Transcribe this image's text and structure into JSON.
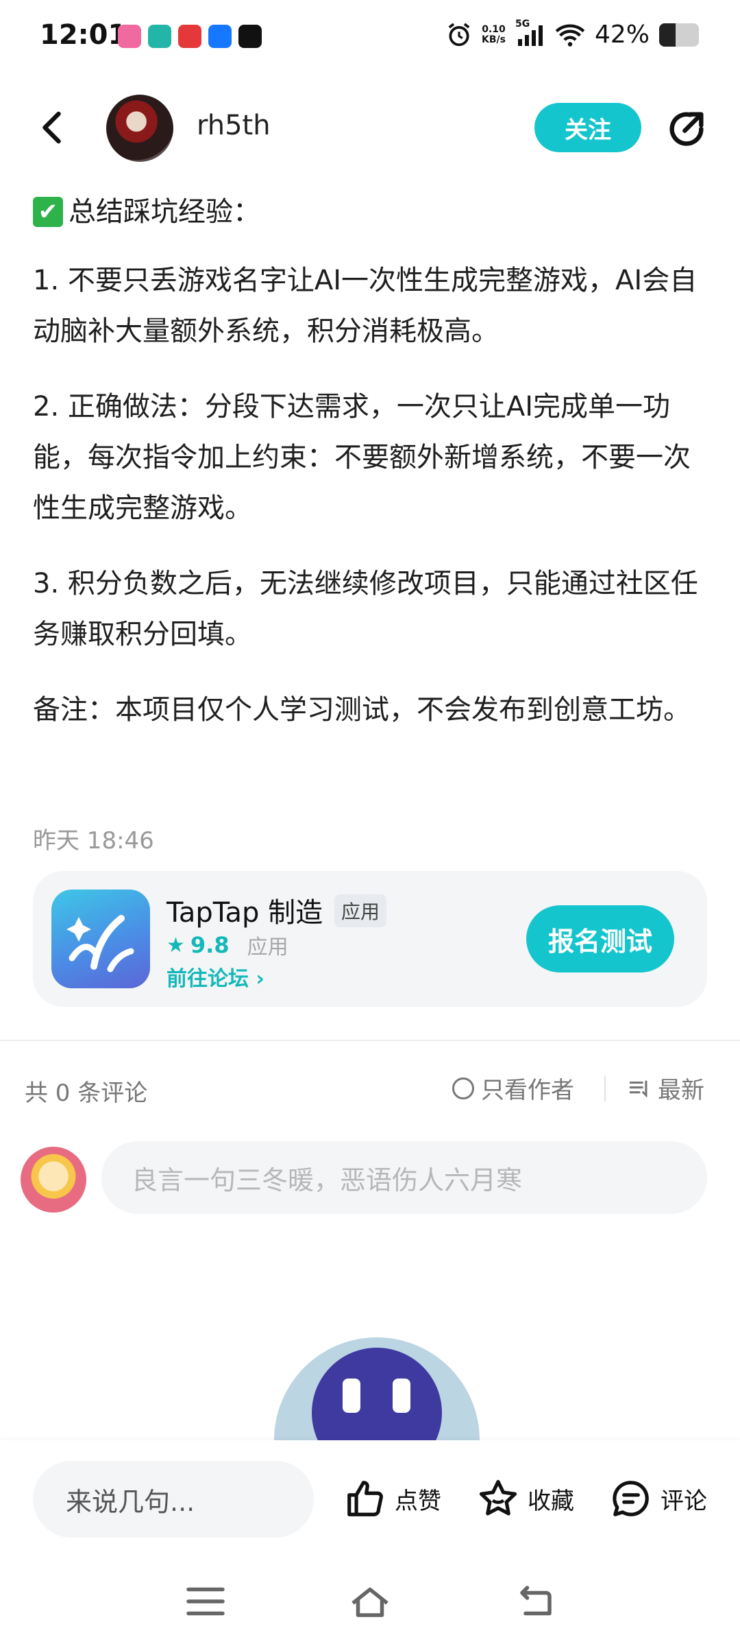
{
  "status_bar": {
    "time": "12:01",
    "net_speed_value": "0.10",
    "net_speed_unit": "KB/s",
    "network": "5G",
    "battery_text": "42%",
    "battery_level": 0.42,
    "app_icons": [
      "lala-icon",
      "boss-zhipin-icon",
      "qidian-icon",
      "alipay-icon",
      "tiktok-icon"
    ]
  },
  "header": {
    "username": "rh5th",
    "follow_label": "关注"
  },
  "post": {
    "heading_icon": "✔",
    "heading": "总结踩坑经验：",
    "paragraphs": [
      "1. 不要只丢游戏名字让AI一次性生成完整游戏，AI会自动脑补大量额外系统，积分消耗极高。",
      "2. 正确做法：分段下达需求，一次只让AI完成单一功能，每次指令加上约束：不要额外新增系统，不要一次性生成完整游戏。",
      "3. 积分负数之后，无法继续修改项目，只能通过社区任务赚取积分回填。",
      "备注：本项目仅个人学习测试，不会发布到创意工坊。"
    ],
    "timestamp": "昨天 18:46"
  },
  "app_card": {
    "name": "TapTap 制造",
    "tag": "应用",
    "rating": "9.8",
    "rating_type": "应用",
    "forum_link": "前往论坛 ›",
    "signup_label": "报名测试"
  },
  "comments": {
    "count_label": "共 0 条评论",
    "only_author_label": "只看作者",
    "sort_label": "最新",
    "input_placeholder": "良言一句三冬暖，恶语伤人六月寒"
  },
  "bottom_bar": {
    "say_placeholder": "来说几句...",
    "like_label": "点赞",
    "collect_label": "收藏",
    "comment_label": "评论"
  },
  "colors": {
    "accent": "#15c5ce",
    "accent_text": "#15b8b8",
    "card_bg": "#f3f5f7"
  }
}
